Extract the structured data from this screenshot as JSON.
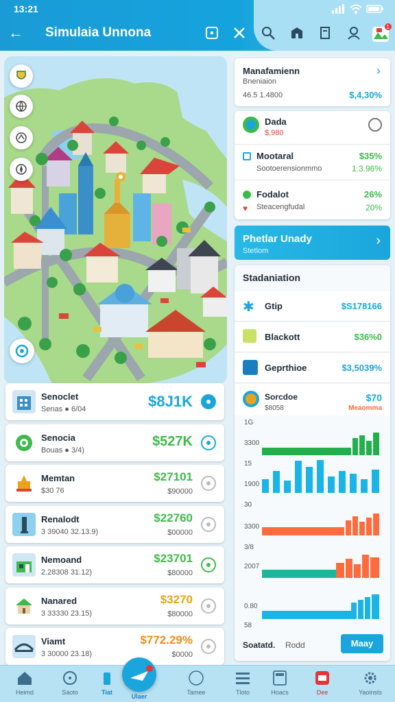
{
  "status": {
    "time": "13:21"
  },
  "header": {
    "title": "Simulaia Unnona",
    "back_label": "←"
  },
  "map": {},
  "left_list": [
    {
      "title": "Senoclet",
      "sub": "Senas  ● 6/04",
      "value": "$8J1K",
      "value_sub": "",
      "color": "#1aa6dc"
    },
    {
      "title": "Senocia",
      "sub": "Bouas ● 3/4)",
      "value": "$527K",
      "value_sub": "",
      "color": "#3dbb4a"
    },
    {
      "title": "Memtan",
      "sub": "$30 76",
      "value": "$27101",
      "value_sub": "$90000",
      "color": "#3dbb4a"
    },
    {
      "title": "Renalodt",
      "sub": "3 39040 32.13.9)",
      "value": "$22760",
      "value_sub": "$00000",
      "color": "#3dbb4a"
    },
    {
      "title": "Nemoand",
      "sub": "2.28308 31.12)",
      "value": "$23701",
      "value_sub": "$80000",
      "color": "#3dbb4a"
    },
    {
      "title": "Nanared",
      "sub": "3 33330 23.15)",
      "value": "$3270",
      "value_sub": "$80000",
      "color": "#e8a21c"
    },
    {
      "title": "Viamt",
      "sub": "3 30000 23.18)",
      "value": "$772.29%",
      "value_sub": "$0000",
      "color": "#ee8b1a"
    }
  ],
  "right": {
    "management": {
      "title": "Manafamienn",
      "sub": "Bneniaion",
      "sub2": "46.5 1.4800",
      "value": "$,4,30%"
    },
    "finance": [
      {
        "title": "Dada",
        "sub": "$,980",
        "value": ""
      },
      {
        "title": "Mootaral",
        "sub": "Sootoerensionmmo",
        "value": "$35%",
        "value2": "1.3.96%"
      },
      {
        "title": "Fodalot",
        "sub": "Steacengfudal",
        "value": "26%",
        "value2": "20%"
      }
    ],
    "banner": {
      "title": "Phetlar Unady",
      "sub": "Stetlom"
    },
    "stats": {
      "title": "Stadaniation",
      "rows": [
        {
          "title": "Gtip",
          "value": "$S178166"
        },
        {
          "title": "Blackott",
          "value": "$36%0"
        },
        {
          "title": "Geprthioe",
          "value": "$3,5039%"
        },
        {
          "title": "Sorcdoe",
          "sub": "$8058",
          "value": "$70",
          "value2": "Meaomma"
        }
      ],
      "chart_labels": [
        "1G",
        "3300",
        "15",
        "1900",
        "30",
        "3300",
        "3/8",
        "2007",
        "0.80",
        "58"
      ],
      "footer": {
        "left": "Soatatd.",
        "mid": "Rodd",
        "button": "Maay"
      }
    }
  },
  "bottom_nav": [
    {
      "label": "Heimd",
      "icon": "home-icon"
    },
    {
      "label": "Saoto",
      "icon": "circle-icon"
    },
    {
      "label": "Tiat",
      "icon": "bottle-icon"
    },
    {
      "label": "Ulaer",
      "icon": "plane-icon"
    },
    {
      "label": "Tamee",
      "icon": "ring-icon"
    },
    {
      "label": "Tloto",
      "icon": "list-icon"
    },
    {
      "label": "Hoacs",
      "icon": "calc-icon"
    },
    {
      "label": "Dee",
      "icon": "card-icon"
    },
    {
      "label": "Yaoinsts",
      "icon": "gear-icon"
    }
  ],
  "colors": {
    "primary": "#1a9bd6",
    "green": "#21b04b",
    "orange": "#ff6b3d",
    "cyan": "#1ab4e6"
  }
}
